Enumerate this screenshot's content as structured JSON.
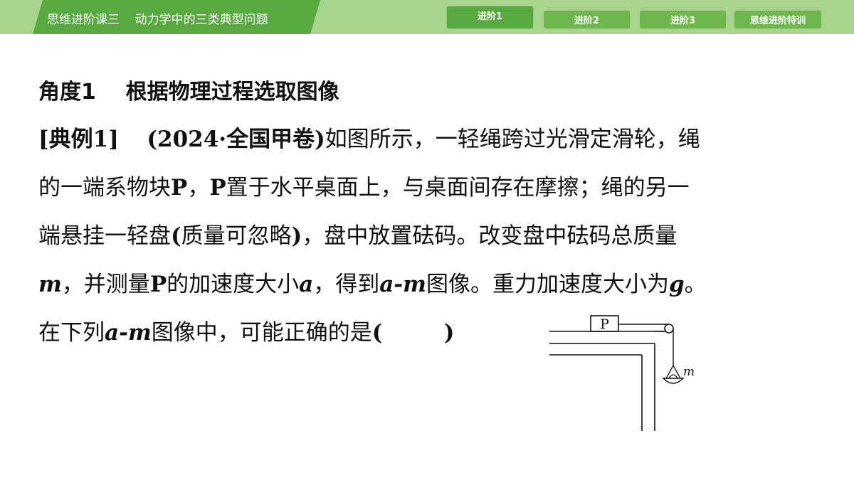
{
  "header": {
    "title": "思维进阶课三    动力学中的三类典型问题",
    "tabs": [
      {
        "label": "进阶1",
        "active": true
      },
      {
        "label": "进阶2",
        "active": false
      },
      {
        "label": "进阶3",
        "active": false
      },
      {
        "label": "思维进阶特训",
        "active": false
      }
    ]
  },
  "content": {
    "heading": "角度1    根据物理过程选取图像",
    "example_tag": "[典例1]",
    "source": "(2024·全国甲卷)",
    "line1_rest": "如图所示，一轻绳跨过光滑定滑轮，绳",
    "line2_a": "的一端系物块",
    "line2_p1": "P",
    "line2_b": "，",
    "line2_p2": "P",
    "line2_c": "置于水平桌面上，与桌面间存在摩擦；绳的另一",
    "line3_a": "端悬挂一轻盘",
    "line3_paren": "(",
    "line3_b": "质量可忽略",
    "line3_paren2": ")",
    "line3_c": "，盘中放置砝码。改变盘中砝码总质量",
    "line4_m": "m",
    "line4_a": "，并测量",
    "line4_p": "P",
    "line4_b": "的加速度大小",
    "line4_accel": "a",
    "line4_c": "，得到",
    "line4_am": "a-m",
    "line4_d": "图像。重力加速度大小为",
    "line4_g": "g",
    "line4_e": "。",
    "line5_a": "在下列",
    "line5_am": "a-m",
    "line5_b": "图像中，可能正确的是",
    "line5_blank": "(        )"
  },
  "figure": {
    "block_label": "P",
    "mass_label": "m"
  },
  "colors": {
    "header_light": "#a9d48e",
    "header_dark": "#58a93f",
    "tab": "#6db74c"
  }
}
